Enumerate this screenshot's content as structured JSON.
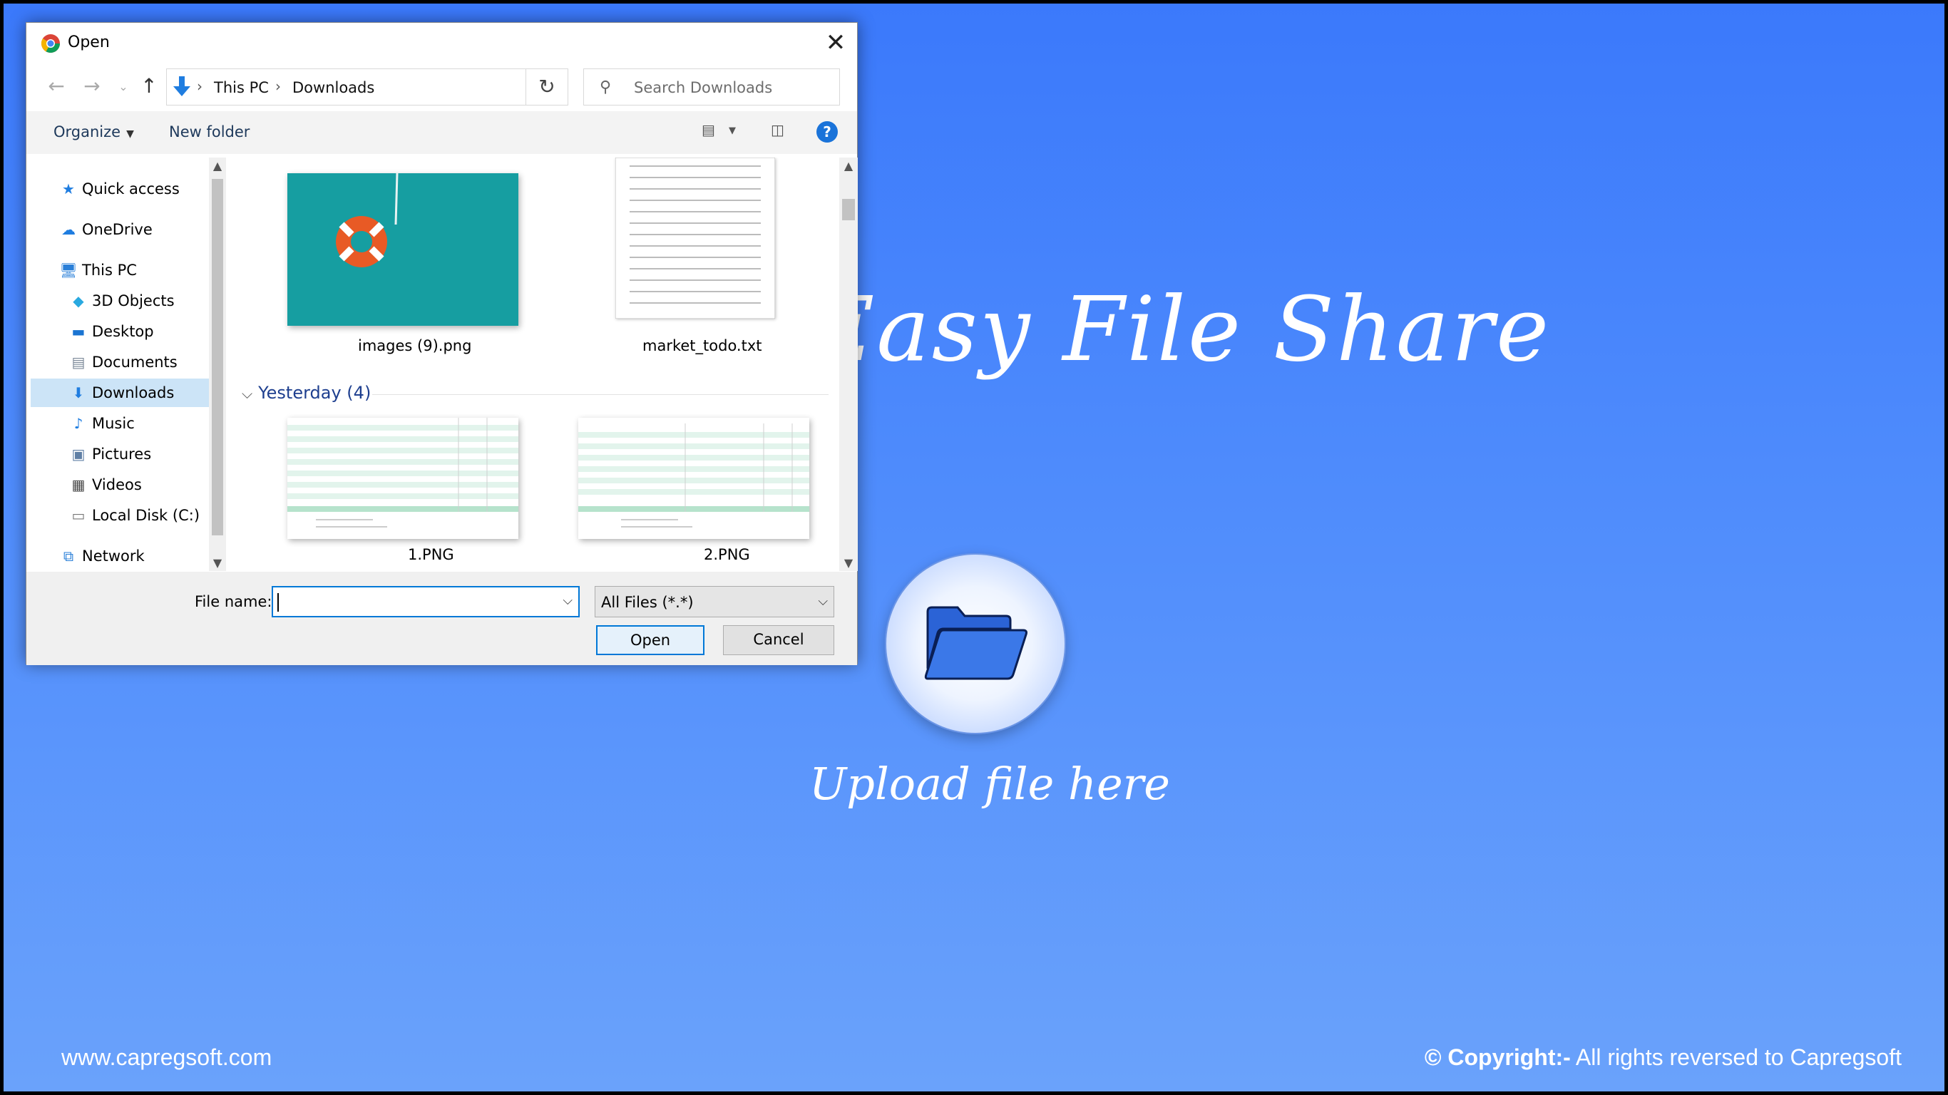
{
  "page": {
    "title": "Easy File Share",
    "upload_label": "Upload file here",
    "footer_left": "www.capregsoft.com",
    "footer_right_bold": "© Copyright:-",
    "footer_right_rest": " All rights reversed to Capregsoft",
    "upload_icon": "folder-open-icon"
  },
  "dialog": {
    "title": "Open",
    "close_glyph": "✕",
    "address": {
      "crumbs": [
        "This PC",
        "Downloads"
      ]
    },
    "search_placeholder": "Search Downloads",
    "toolbar": {
      "organize": "Organize",
      "new_folder": "New folder",
      "help": "?"
    },
    "sidebar": [
      {
        "label": "Quick access",
        "icon": "star-icon"
      },
      {
        "label": "OneDrive",
        "icon": "cloud-icon"
      },
      {
        "label": "This PC",
        "icon": "computer-icon"
      },
      {
        "label": "3D Objects",
        "icon": "cube-icon"
      },
      {
        "label": "Desktop",
        "icon": "desktop-icon"
      },
      {
        "label": "Documents",
        "icon": "document-icon"
      },
      {
        "label": "Downloads",
        "icon": "download-icon",
        "selected": true
      },
      {
        "label": "Music",
        "icon": "music-icon"
      },
      {
        "label": "Pictures",
        "icon": "pictures-icon"
      },
      {
        "label": "Videos",
        "icon": "video-icon"
      },
      {
        "label": "Local Disk (C:)",
        "icon": "disk-icon"
      },
      {
        "label": "Network",
        "icon": "network-icon"
      }
    ],
    "files_top": [
      {
        "name": "images (9).png"
      },
      {
        "name": "market_todo.txt"
      }
    ],
    "group_header": "Yesterday (4)",
    "files_yesterday": [
      {
        "name": "1.PNG"
      },
      {
        "name": "2.PNG"
      }
    ],
    "file_name_label": "File name:",
    "file_name_value": "",
    "file_type": "All Files (*.*)",
    "open_button": "Open",
    "cancel_button": "Cancel"
  }
}
